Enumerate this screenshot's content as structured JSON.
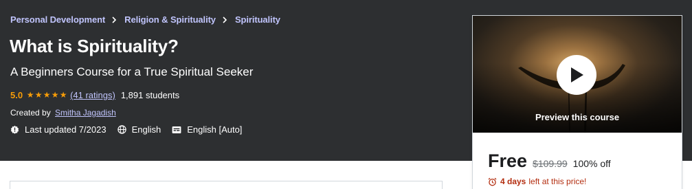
{
  "breadcrumb": {
    "items": [
      {
        "label": "Personal Development"
      },
      {
        "label": "Religion & Spirituality"
      },
      {
        "label": "Spirituality"
      }
    ]
  },
  "course": {
    "title": "What is Spirituality?",
    "subtitle": "A Beginners Course for a True Spiritual Seeker",
    "rating": "5.0",
    "stars": 5,
    "ratings_count": "(41 ratings)",
    "students": "1,891 students",
    "created_by_label": "Created by",
    "author": "Smitha Jagadish",
    "last_updated": "Last updated 7/2023",
    "language": "English",
    "captions": "English [Auto]"
  },
  "sidebar": {
    "preview_label": "Preview this course",
    "price_now": "Free",
    "price_old": "$109.99",
    "discount": "100% off",
    "countdown_bold": "4 days",
    "countdown_text": "left at this price!"
  },
  "colors": {
    "hero_bg": "#2d2f31",
    "link_purple": "#c0c4fc",
    "rating_orange": "#f69c08",
    "urgent_red": "#b32d0f"
  },
  "icons": [
    "chevron-right-icon",
    "star-icon",
    "alert-badge-icon",
    "globe-icon",
    "closed-captions-icon",
    "play-icon",
    "alarm-clock-icon"
  ]
}
